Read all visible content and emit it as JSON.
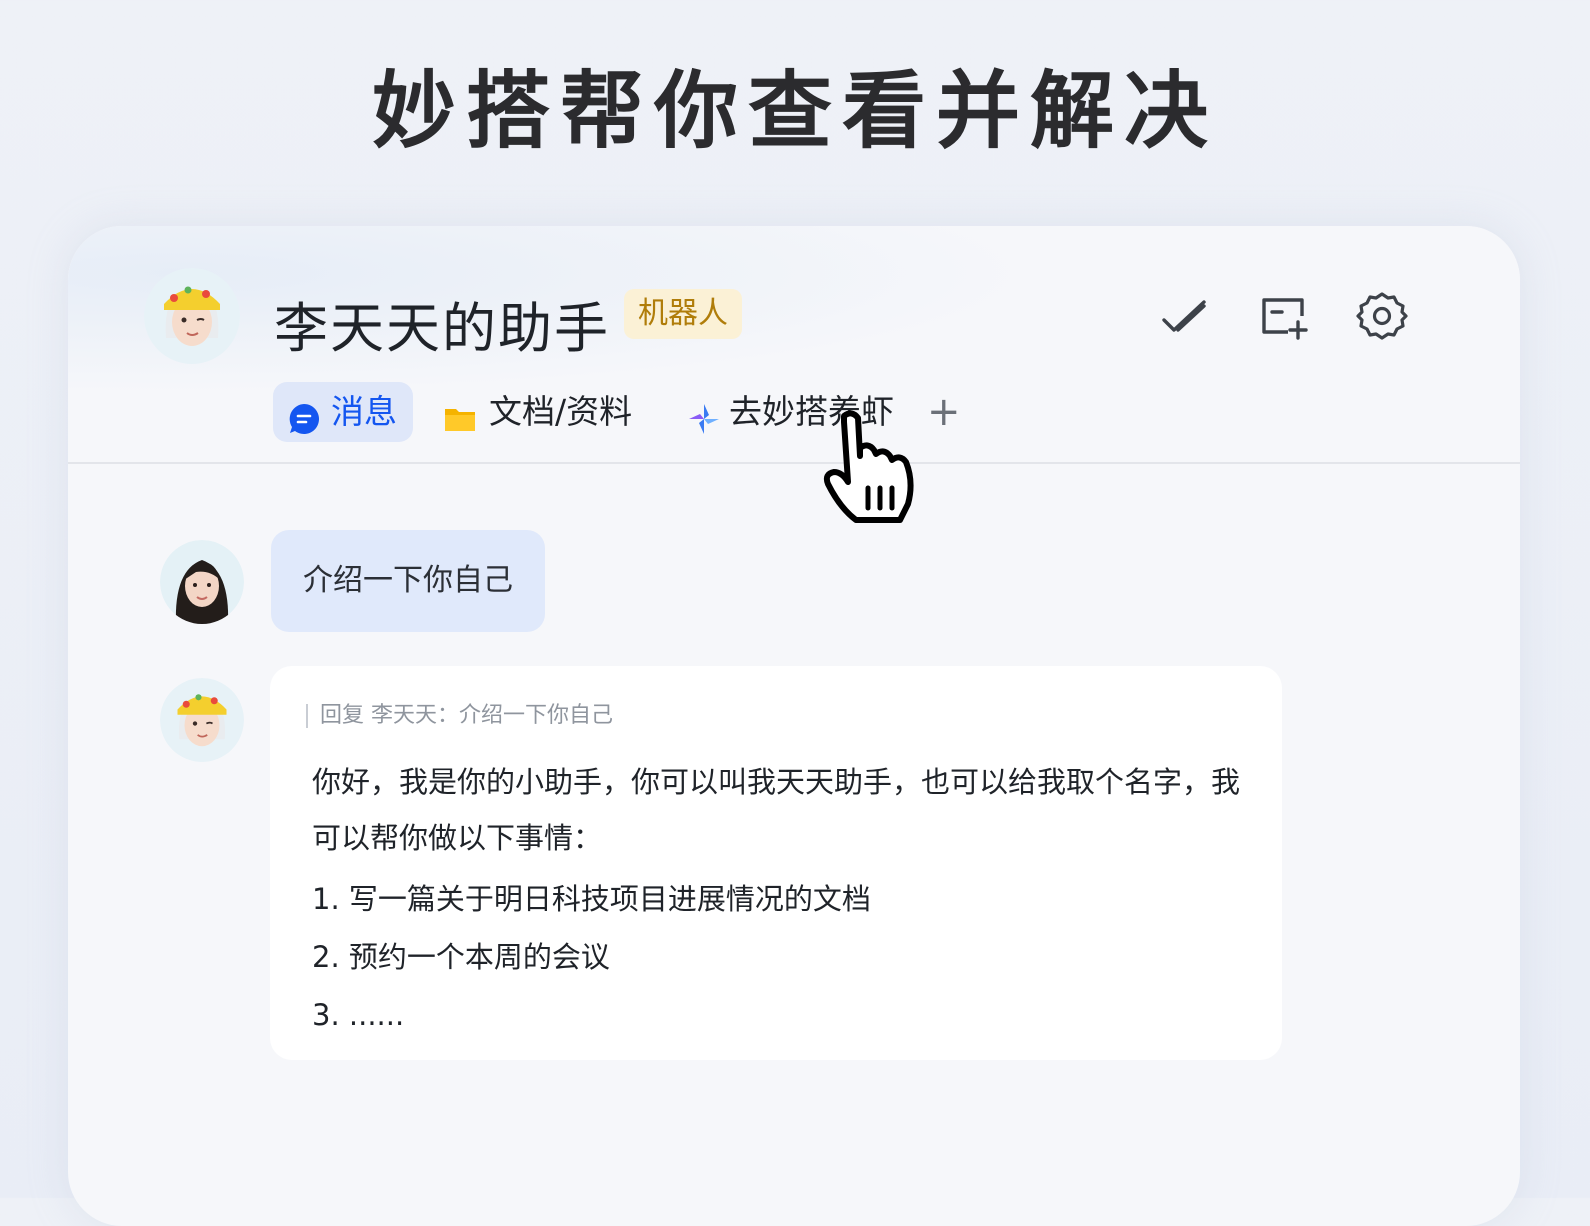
{
  "headline": "妙搭帮你查看并解决",
  "header": {
    "bot_name": "李天天的助手",
    "bot_tag": "机器人",
    "actions": [
      {
        "name": "check-icon"
      },
      {
        "name": "add-window-icon"
      },
      {
        "name": "gear-icon"
      }
    ]
  },
  "tabs": [
    {
      "label": "消息",
      "icon": "chat-bubble-icon",
      "active": true
    },
    {
      "label": "文档/资料",
      "icon": "folder-icon"
    },
    {
      "label": "去妙搭养虾",
      "icon": "miaoda-logo-icon"
    }
  ],
  "add_tab_symbol": "+",
  "chat": {
    "user_message": "介绍一下你自己",
    "reply_quote": "回复 李天天：介绍一下你自己",
    "bot_intro": "你好，我是你的小助手，你可以叫我天天助手，也可以给我取个名字，我可以帮你做以下事情：",
    "bot_list": [
      "1. 写一篇关于明日科技项目进展情况的文档",
      "2. 预约一个本周的会议",
      "3. ......"
    ]
  },
  "colors": {
    "accent": "#1456f0",
    "tag_bg": "#fbf1d6",
    "tag_text": "#b07d0a",
    "user_bubble": "#e0e9fb"
  }
}
